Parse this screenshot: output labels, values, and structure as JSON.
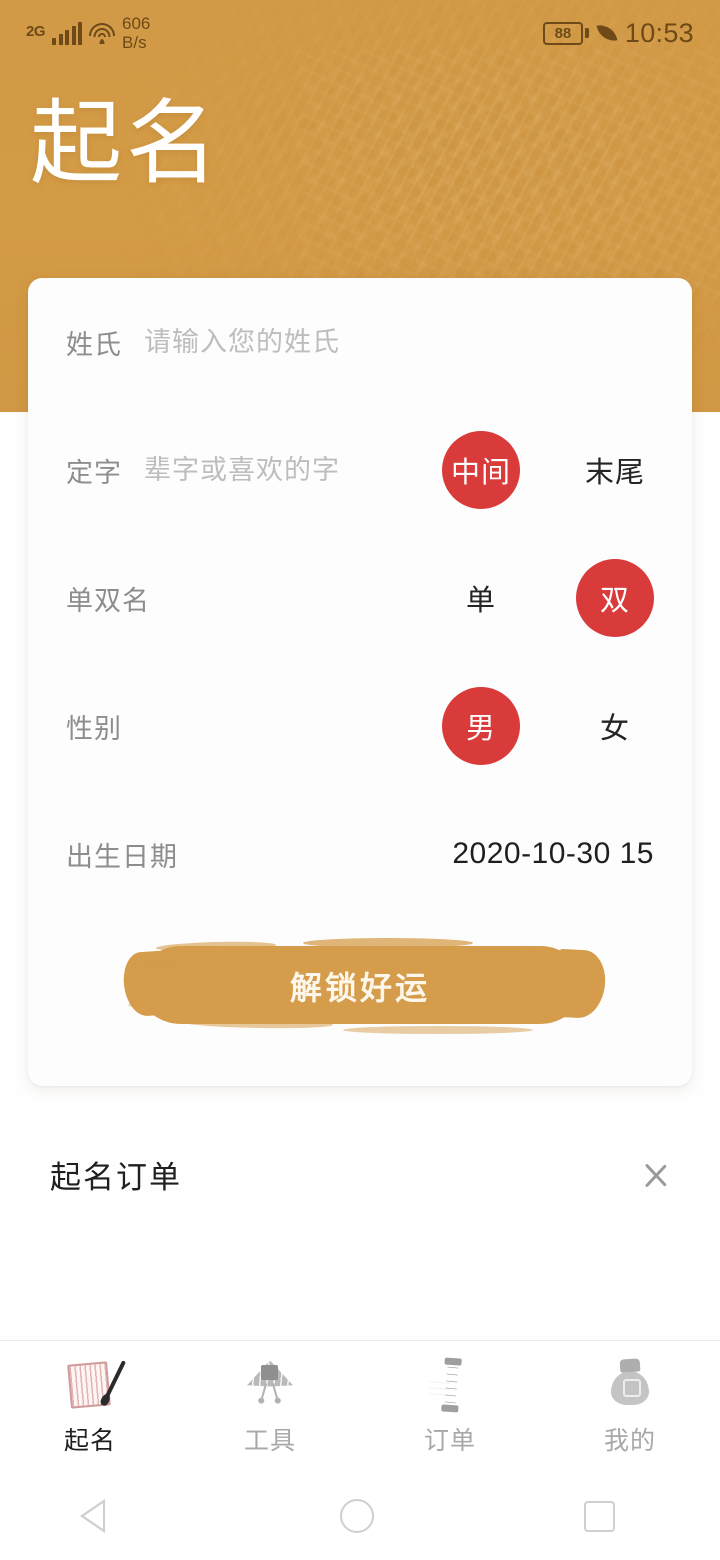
{
  "status_bar": {
    "network_type": "2G",
    "signal_icon": "signal-bars-icon",
    "wifi_icon": "wifi-icon",
    "net_speed_value": "606",
    "net_speed_unit": "B/s",
    "battery_level": "88",
    "battery_icon": "battery-icon",
    "power_saving_icon": "leaf-icon",
    "time": "10:53"
  },
  "header": {
    "title": "起名",
    "background_color": "#d49b46"
  },
  "form": {
    "rows": [
      {
        "label": "姓氏",
        "placeholder": "请输入您的姓氏",
        "value": ""
      },
      {
        "label": "定字",
        "placeholder": "辈字或喜欢的字",
        "value": "",
        "options": [
          "中间",
          "末尾"
        ],
        "selected": "中间"
      },
      {
        "label": "单双名",
        "options": [
          "单",
          "双"
        ],
        "selected": "双"
      },
      {
        "label": "性别",
        "options": [
          "男",
          "女"
        ],
        "selected": "男"
      },
      {
        "label": "出生日期",
        "value": "2020-10-30 15"
      }
    ],
    "submit_label": "解锁好运",
    "accent_selected_color": "#d93b3b",
    "submit_color": "#d49c4b"
  },
  "order_link": {
    "label": "起名订单",
    "chevron_icon": "chevron-right-icon"
  },
  "tabbar": {
    "items": [
      {
        "label": "起名",
        "icon": "book-brush-icon",
        "active": true
      },
      {
        "label": "工具",
        "icon": "fan-icon",
        "active": false
      },
      {
        "label": "订单",
        "icon": "bamboo-scroll-icon",
        "active": false
      },
      {
        "label": "我的",
        "icon": "money-bag-icon",
        "active": false
      }
    ]
  },
  "navbar": {
    "back_icon": "triangle-back-icon",
    "home_icon": "circle-home-icon",
    "recents_icon": "square-recents-icon"
  }
}
